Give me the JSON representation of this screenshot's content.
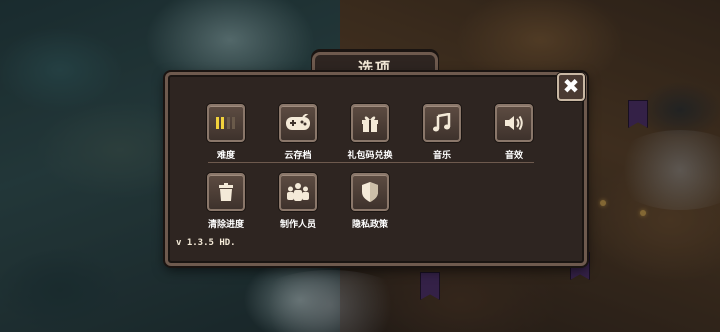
{
  "dialog": {
    "title": "选项",
    "close_symbol": "✖",
    "version": "v 1.3.5  HD."
  },
  "options_row1": [
    {
      "label": "难度",
      "icon": "difficulty-bars-icon"
    },
    {
      "label": "云存档",
      "icon": "gamepad-icon"
    },
    {
      "label": "礼包码兑换",
      "icon": "gift-icon"
    },
    {
      "label": "音乐",
      "icon": "music-note-icon"
    },
    {
      "label": "音效",
      "icon": "speaker-icon"
    }
  ],
  "options_row2": [
    {
      "label": "清除进度",
      "icon": "trash-can-icon"
    },
    {
      "label": "制作人员",
      "icon": "people-icon"
    },
    {
      "label": "隐私政策",
      "icon": "shield-icon"
    }
  ],
  "colors": {
    "panel_bg": "#2e2521",
    "panel_border": "#6e5a4e",
    "difficulty_active": "#f2d23c",
    "difficulty_inactive": "#6a5a4a"
  }
}
